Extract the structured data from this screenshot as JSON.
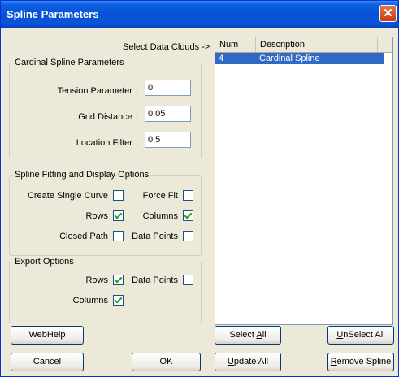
{
  "window": {
    "title": "Spline Parameters",
    "close_glyph": "✕"
  },
  "select_data_label": "Select Data Clouds ->",
  "cardinal": {
    "legend": "Cardinal Spline Parameters",
    "tension_label": "Tension Parameter :",
    "tension_value": "0",
    "grid_label": "Grid Distance :",
    "grid_value": "0.05",
    "location_label": "Location Filter :",
    "location_value": "0.5"
  },
  "fitting": {
    "legend": "Spline Fitting and Display Options",
    "create_single_curve": {
      "label": "Create Single Curve",
      "checked": false
    },
    "force_fit": {
      "label": "Force Fit",
      "checked": false
    },
    "rows": {
      "label": "Rows",
      "checked": true
    },
    "columns": {
      "label": "Columns",
      "checked": true
    },
    "closed_path": {
      "label": "Closed Path",
      "checked": false
    },
    "data_points": {
      "label": "Data Points",
      "checked": false
    }
  },
  "export": {
    "legend": "Export Options",
    "rows": {
      "label": "Rows",
      "checked": true
    },
    "data_points": {
      "label": "Data Points",
      "checked": false
    },
    "columns": {
      "label": "Columns",
      "checked": true
    }
  },
  "list": {
    "columns": [
      "Num",
      "Description"
    ],
    "rows": [
      {
        "num": "4",
        "description": "Cardinal Spline",
        "selected": true
      }
    ]
  },
  "buttons": {
    "webhelp": "WebHelp",
    "cancel": "Cancel",
    "ok": "OK",
    "select_all": {
      "u": "A",
      "pre": "Select ",
      "post": "ll"
    },
    "unselect_all": {
      "u": "U",
      "pre": "",
      "post": "nSelect All"
    },
    "update_all": {
      "u": "U",
      "pre": "",
      "post": "pdate All"
    },
    "remove_spline": {
      "u": "R",
      "pre": "",
      "post": "emove Spline"
    }
  }
}
